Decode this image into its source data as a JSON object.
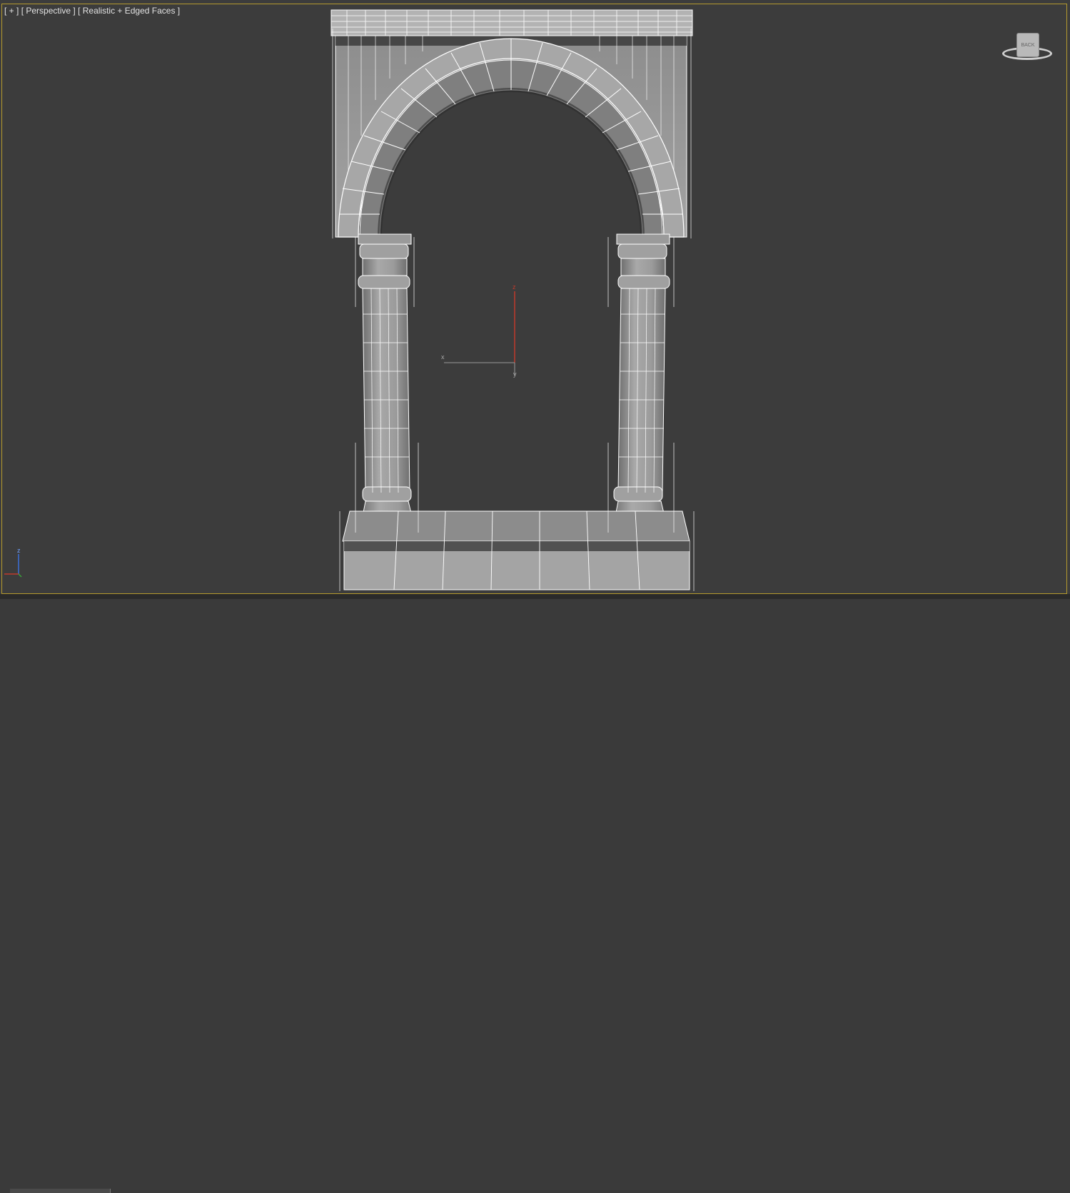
{
  "viewport": {
    "plus_label": "[ + ]",
    "view_label": "[ Perspective ]",
    "shading_label": "[ Realistic + Edged Faces ]"
  },
  "viewcube": {
    "face_label": "BACK"
  },
  "gizmo": {
    "x_label": "x",
    "y_label": "y",
    "z_label": "z"
  },
  "world_axis": {
    "z_label": "z"
  },
  "colors": {
    "background": "#3c3c3c",
    "active_border": "#b59a2e",
    "mesh": "#9a9a9a",
    "wire": "#ffffff",
    "z_axis": "#c0392b"
  }
}
